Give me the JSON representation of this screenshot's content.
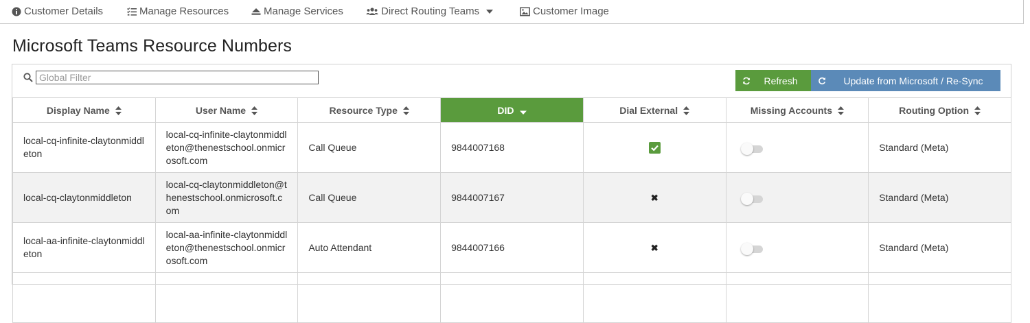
{
  "nav": {
    "items": [
      {
        "label": "Customer Details",
        "icon": "info-circle-icon"
      },
      {
        "label": "Manage Resources",
        "icon": "list-check-icon"
      },
      {
        "label": "Manage Services",
        "icon": "stack-icon"
      },
      {
        "label": "Direct Routing Teams",
        "icon": "users-icon"
      },
      {
        "label": "Customer Image",
        "icon": "image-icon"
      }
    ]
  },
  "page": {
    "title": "Microsoft Teams Resource Numbers"
  },
  "filter": {
    "placeholder": "Global Filter",
    "value": ""
  },
  "buttons": {
    "refresh": "Refresh",
    "sync": "Update from Microsoft / Re-Sync"
  },
  "colors": {
    "accent_green": "#5a9b3d",
    "accent_blue": "#5b8ab8"
  },
  "table": {
    "columns": [
      "Display Name",
      "User Name",
      "Resource Type",
      "DID",
      "Dial External",
      "Missing Accounts",
      "Routing Option"
    ],
    "sorted_column": "DID",
    "sort_direction": "descending",
    "rows": [
      {
        "display_name": "local-cq-infinite-claytonmiddleton",
        "user_name": "local-cq-infinite-claytonmiddleton@thenestschool.onmicrosoft.com",
        "resource_type": "Call Queue",
        "did": "9844007168",
        "dial_external": true,
        "missing_accounts": false,
        "routing_option": "Standard (Meta)"
      },
      {
        "display_name": "local-cq-claytonmiddleton",
        "user_name": "local-cq-claytonmiddleton@thenestschool.onmicrosoft.com",
        "resource_type": "Call Queue",
        "did": "9844007167",
        "dial_external": false,
        "missing_accounts": false,
        "routing_option": "Standard (Meta)"
      },
      {
        "display_name": "local-aa-infinite-claytonmiddleton",
        "user_name": "local-aa-infinite-claytonmiddleton@thenestschool.onmicrosoft.com",
        "resource_type": "Auto Attendant",
        "did": "9844007166",
        "dial_external": false,
        "missing_accounts": false,
        "routing_option": "Standard (Meta)"
      }
    ]
  }
}
